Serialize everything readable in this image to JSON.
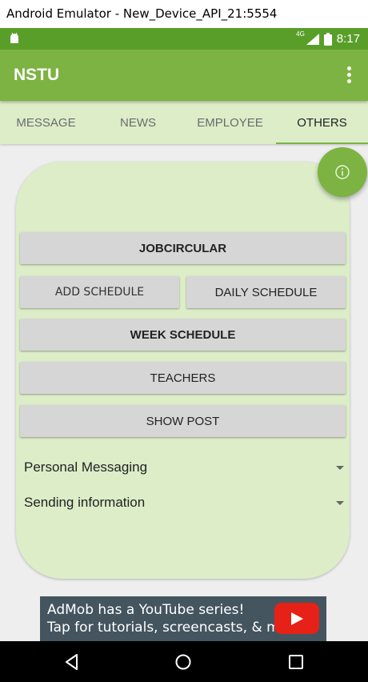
{
  "window": {
    "title": "Android Emulator - New_Device_API_21:5554"
  },
  "status_bar": {
    "network": "4G",
    "time": "8:17"
  },
  "app_bar": {
    "title": "NSTU"
  },
  "tabs": [
    {
      "label": "MESSAGE",
      "active": false
    },
    {
      "label": "NEWS",
      "active": false
    },
    {
      "label": "EMPLOYEE",
      "active": false
    },
    {
      "label": "OTHERS",
      "active": true
    }
  ],
  "buttons": {
    "jobcircular": "JOBCIRCULAR",
    "add_schedule": "ADD SCHEDULE",
    "daily_schedule": "DAILY SCHEDULE",
    "week_schedule": "WEEK SCHEDULE",
    "teachers": "TEACHERS",
    "show_post": "SHOW POST"
  },
  "spinners": [
    {
      "selected": "Personal Messaging"
    },
    {
      "selected": "Sending information"
    }
  ],
  "fab": {
    "icon": "info-icon"
  },
  "ad": {
    "line1": "AdMob has a YouTube series!",
    "line2": "Tap for tutorials, screencasts, & more.",
    "icon": "youtube-play-icon"
  },
  "nav": {
    "back": "back-icon",
    "home": "home-icon",
    "recents": "recents-icon"
  },
  "colors": {
    "status_bar": "#5a9e2a",
    "app_bar": "#7cb342",
    "tab_bar": "#dcedc8",
    "card": "#dcedc8",
    "button": "#d6d6d6",
    "ad_background": "#44555f",
    "ad_play": "#e62117"
  }
}
